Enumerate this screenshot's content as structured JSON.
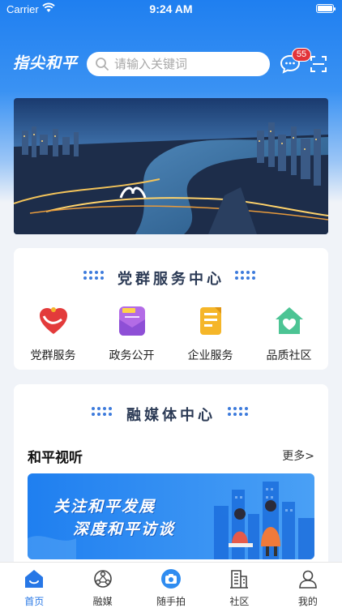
{
  "status_bar": {
    "carrier": "Carrier",
    "time": "9:24 AM"
  },
  "header": {
    "logo_text": "指尖和平",
    "search_placeholder": "请输入关键词",
    "message_badge": "55"
  },
  "party_center": {
    "title": "党群服务中心",
    "items": [
      {
        "label": "党群服务",
        "icon": "party-heart-icon"
      },
      {
        "label": "政务公开",
        "icon": "news-envelope-icon"
      },
      {
        "label": "企业服务",
        "icon": "document-icon"
      },
      {
        "label": "品质社区",
        "icon": "house-heart-icon"
      }
    ]
  },
  "media_center": {
    "title": "融媒体中心",
    "subsection_title": "和平视听",
    "more_label": "更多>",
    "promo_line1": "关注和平发展",
    "promo_line2": "深度和平访谈"
  },
  "tabbar": {
    "items": [
      {
        "label": "首页",
        "icon": "home-icon",
        "active": true
      },
      {
        "label": "融媒",
        "icon": "media-icon",
        "active": false
      },
      {
        "label": "随手拍",
        "icon": "camera-icon",
        "active": false
      },
      {
        "label": "社区",
        "icon": "building-icon",
        "active": false
      },
      {
        "label": "我的",
        "icon": "user-icon",
        "active": false
      }
    ]
  },
  "colors": {
    "primary": "#2777e6",
    "badge": "#e2343a",
    "title_text": "#2b3a55"
  }
}
